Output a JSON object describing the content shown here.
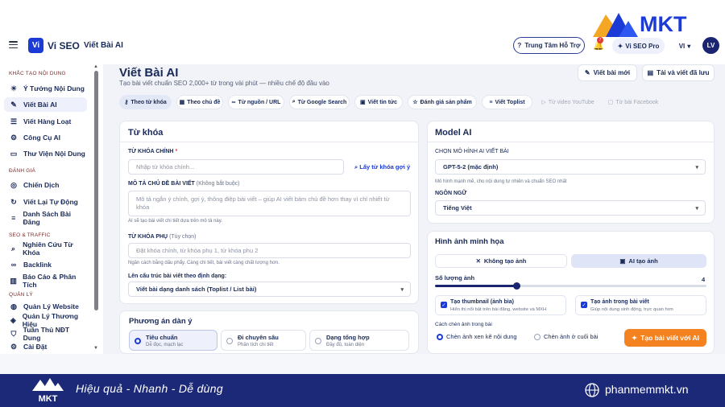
{
  "header": {
    "app_name": "Vi SEO",
    "app_badge": "Vi",
    "breadcrumb": "Viết Bài AI",
    "support": "Trung Tâm Hỗ Trợ",
    "notif_count": "7",
    "pro": "Vi SEO Pro",
    "lang": "VI",
    "avatar": "LV"
  },
  "brand_logo": {
    "text": "MKT",
    "color": "#1c3bd6",
    "accent": "#f5a623"
  },
  "sidebar": {
    "sections": [
      {
        "title": "KHẮC TẠO NỘI DUNG"
      },
      {
        "title": "ĐÁNH GIÁ"
      },
      {
        "title": "SEO & TRAFFIC"
      },
      {
        "title": "QUẢN LÝ"
      }
    ],
    "items": [
      {
        "label": "Ý Tưởng Nội Dung",
        "icon": "lightbulb-icon"
      },
      {
        "label": "Viết Bài AI",
        "icon": "pen-icon"
      },
      {
        "label": "Viết Hàng Loạt",
        "icon": "layers-icon"
      },
      {
        "label": "Công Cụ AI",
        "icon": "robot-icon"
      },
      {
        "label": "Thư Viện Nội Dung",
        "icon": "folder-icon"
      },
      {
        "label": "Chiến Dịch",
        "icon": "target-icon"
      },
      {
        "label": "Viết Lại Tự Động",
        "icon": "refresh-icon"
      },
      {
        "label": "Danh Sách Bài Đăng",
        "icon": "list-icon"
      },
      {
        "label": "Nghiên Cứu Từ Khóa",
        "icon": "search-icon"
      },
      {
        "label": "Backlink",
        "icon": "link-icon"
      },
      {
        "label": "Báo Cáo & Phân Tích",
        "icon": "chart-icon"
      },
      {
        "label": "Quản Lý Website",
        "icon": "globe-icon"
      },
      {
        "label": "Quản Lý Thương Hiệu",
        "icon": "tag-icon"
      },
      {
        "label": "Tuân Thủ NĐT Dung",
        "icon": "shield-icon"
      },
      {
        "label": "Cài Đặt",
        "icon": "gear-icon"
      }
    ]
  },
  "page": {
    "title": "Viết Bài AI",
    "subtitle": "Tạo bài viết chuẩn SEO 2,000+ từ trong vài phút — nhiều chế độ đầu vào",
    "new_btn": "Viết bài mới",
    "download_btn": "Tải và viết đã lưu"
  },
  "tabs": [
    {
      "label": "Theo từ khóa"
    },
    {
      "label": "Theo chủ đề"
    },
    {
      "label": "Từ nguồn / URL"
    },
    {
      "label": "Từ Google Search"
    },
    {
      "label": "Viết tin tức"
    },
    {
      "label": "Đánh giá sản phẩm"
    },
    {
      "label": "Viết Toplist"
    },
    {
      "label": "Từ video YouTube"
    },
    {
      "label": "Từ bài Facebook"
    }
  ],
  "keyword_card": {
    "title": "Từ khóa",
    "main_label": "TỪ KHÓA CHÍNH",
    "main_req": "*",
    "main_placeholder": "Nhập từ khóa chính...",
    "suggest_link": "Lấy từ khóa gợi ý",
    "desc_label": "MÔ TẢ CHỦ ĐỀ BÀI VIẾT",
    "desc_optional": "(Không bắt buộc)",
    "desc_placeholder": "Mô tả ngắn ý chính, gợi ý, thông điệp bài viết – giúp AI viết bám chủ đề hơn thay vì chỉ nhiết từ khóa",
    "desc_hint": "AI sẽ tạo bài viết chi tiết dựa trên mô tả này.",
    "sub_label": "TỪ KHÓA PHỤ",
    "sub_optional": "(Tùy chọn)",
    "sub_placeholder": "Đặt khóa chính, từ khóa phụ 1, từ khóa phụ 2",
    "sub_hint": "Ngăn cách bằng dấu phẩy. Càng chi tiết, bài viết càng chất lượng hơn.",
    "structure_label": "Lên cấu trúc bài viết theo định dạng:",
    "structure_value": "Viết bài dạng danh sách (Toplist / List bài)"
  },
  "outline_card": {
    "title": "Phương án dàn ý",
    "options": [
      {
        "title": "Tiêu chuẩn",
        "sub": "Dễ đọc, mạch lạc"
      },
      {
        "title": "Đi chuyên sâu",
        "sub": "Phân tích chi tiết"
      },
      {
        "title": "Dạng tổng hợp",
        "sub": "Đầy đủ, toàn diện"
      }
    ]
  },
  "model_card": {
    "title": "Model AI",
    "model_label": "CHỌN MÔ HÌNH AI VIẾT BÀI",
    "model_value": "GPT-5-2 (mặc định)",
    "model_hint": "Mô hình mạnh mẽ, cho nội dung tự nhiên và chuẩn SEO nhất",
    "lang_label": "NGÔN NGỮ",
    "lang_value": "Tiếng Việt"
  },
  "image_card": {
    "title": "Hình ảnh minh họa",
    "no_image": "Không tạo ảnh",
    "ai_image": "AI tạo ảnh",
    "count_label": "Số lượng ảnh",
    "count_value": "4",
    "count_fraction": 0.3,
    "thumb_title": "Tạo thumbnail (ảnh bìa)",
    "thumb_sub": "Hiển thị nổi bật trên bài đăng, website và MXH",
    "inline_title": "Tạo ảnh trong bài viết",
    "inline_sub": "Giúp nội dung sinh động, trực quan hơn",
    "insert_label": "Cách chèn ảnh trong bài",
    "insert_opt1": "Chèn ảnh xen kẽ nội dung",
    "insert_opt2": "Chèn ảnh ở cuối bài",
    "cta": "Tạo bài viết với AI"
  },
  "footer": {
    "logo_text": "MKT",
    "slogan": "Hiệu quả - Nhanh - Dễ dùng",
    "site": "phanmemmkt.vn"
  }
}
